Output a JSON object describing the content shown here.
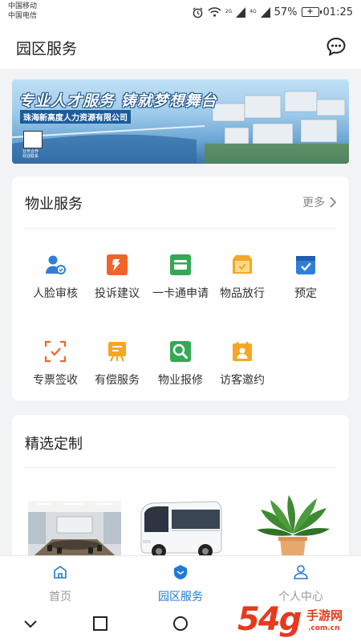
{
  "status_bar": {
    "carrier_1": "中国移动",
    "carrier_2": "中国电信",
    "network_1": "2G",
    "network_2": "4G",
    "battery": "57%",
    "time": "01:25"
  },
  "header": {
    "title": "园区服务",
    "chat_icon": "chat-bubble-icon"
  },
  "banner": {
    "headline": "专业人才服务 铸就梦想舞台",
    "company": "珠海新高度人力资源有限公司",
    "small_text_1": "业务合作",
    "small_text_2": "欢迎联系"
  },
  "property_services": {
    "title": "物业服务",
    "more": "更多",
    "items": [
      {
        "label": "人脸审核",
        "icon": "face-audit-icon",
        "color": "#2f7fd8"
      },
      {
        "label": "投诉建议",
        "icon": "complaint-icon",
        "color": "#f0642a"
      },
      {
        "label": "一卡通申请",
        "icon": "card-apply-icon",
        "color": "#35a853"
      },
      {
        "label": "物品放行",
        "icon": "item-release-icon",
        "color": "#f5a623"
      },
      {
        "label": "预定",
        "icon": "booking-icon",
        "color": "#2f7fd8"
      },
      {
        "label": "专票签收",
        "icon": "ticket-receipt-icon",
        "color": "#f0642a"
      },
      {
        "label": "有偿服务",
        "icon": "paid-service-icon",
        "color": "#f5a623"
      },
      {
        "label": "物业报修",
        "icon": "repair-icon",
        "color": "#35a853"
      },
      {
        "label": "访客邀约",
        "icon": "visitor-invite-icon",
        "color": "#f5a623"
      }
    ]
  },
  "selected": {
    "title": "精选定制",
    "products": [
      "meeting-room-image",
      "bus-image",
      "plant-image"
    ]
  },
  "bottom_nav": {
    "items": [
      {
        "label": "首页",
        "icon": "home-icon",
        "active": false
      },
      {
        "label": "园区服务",
        "icon": "park-service-icon",
        "active": true
      },
      {
        "label": "个人中心",
        "icon": "profile-icon",
        "active": false
      }
    ]
  },
  "watermark": {
    "main": "54g",
    "text": "手游网",
    "domain": ".com.cn"
  },
  "colors": {
    "accent": "#1e7ad6",
    "background": "#f2f3f5"
  }
}
